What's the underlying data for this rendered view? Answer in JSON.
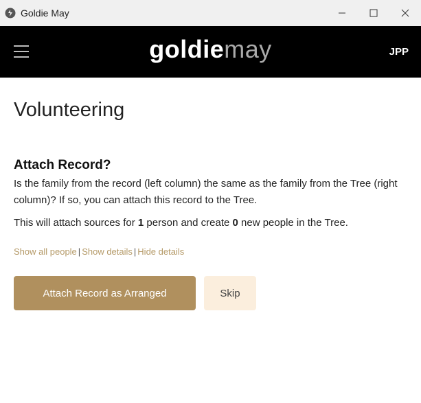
{
  "window": {
    "title": "Goldie May",
    "minimize_glyph": "–",
    "maximize_glyph": "☐",
    "close_glyph": "✕"
  },
  "navbar": {
    "logo_bold": "goldie",
    "logo_light": "may",
    "user_initials": "JPP",
    "background": "#000000"
  },
  "page": {
    "title": "Volunteering",
    "section_heading": "Attach Record?",
    "description": "Is the family from the record (left column) the same as the family from the Tree (right column)? If so, you can attach this record to the Tree.",
    "summary_prefix": "This will attach sources for ",
    "persons_count": "1",
    "summary_middle": " person and create ",
    "new_people_count": "0",
    "summary_suffix": " new people in the Tree."
  },
  "links": {
    "show_all_people": "Show all people",
    "show_details": "Show details",
    "hide_details": "Hide details",
    "separator": "|"
  },
  "actions": {
    "attach_label": "Attach Record as Arranged",
    "skip_label": "Skip"
  },
  "colors": {
    "accent": "#b0905e",
    "link": "#b59a68",
    "secondary_button": "#fbeedd"
  }
}
